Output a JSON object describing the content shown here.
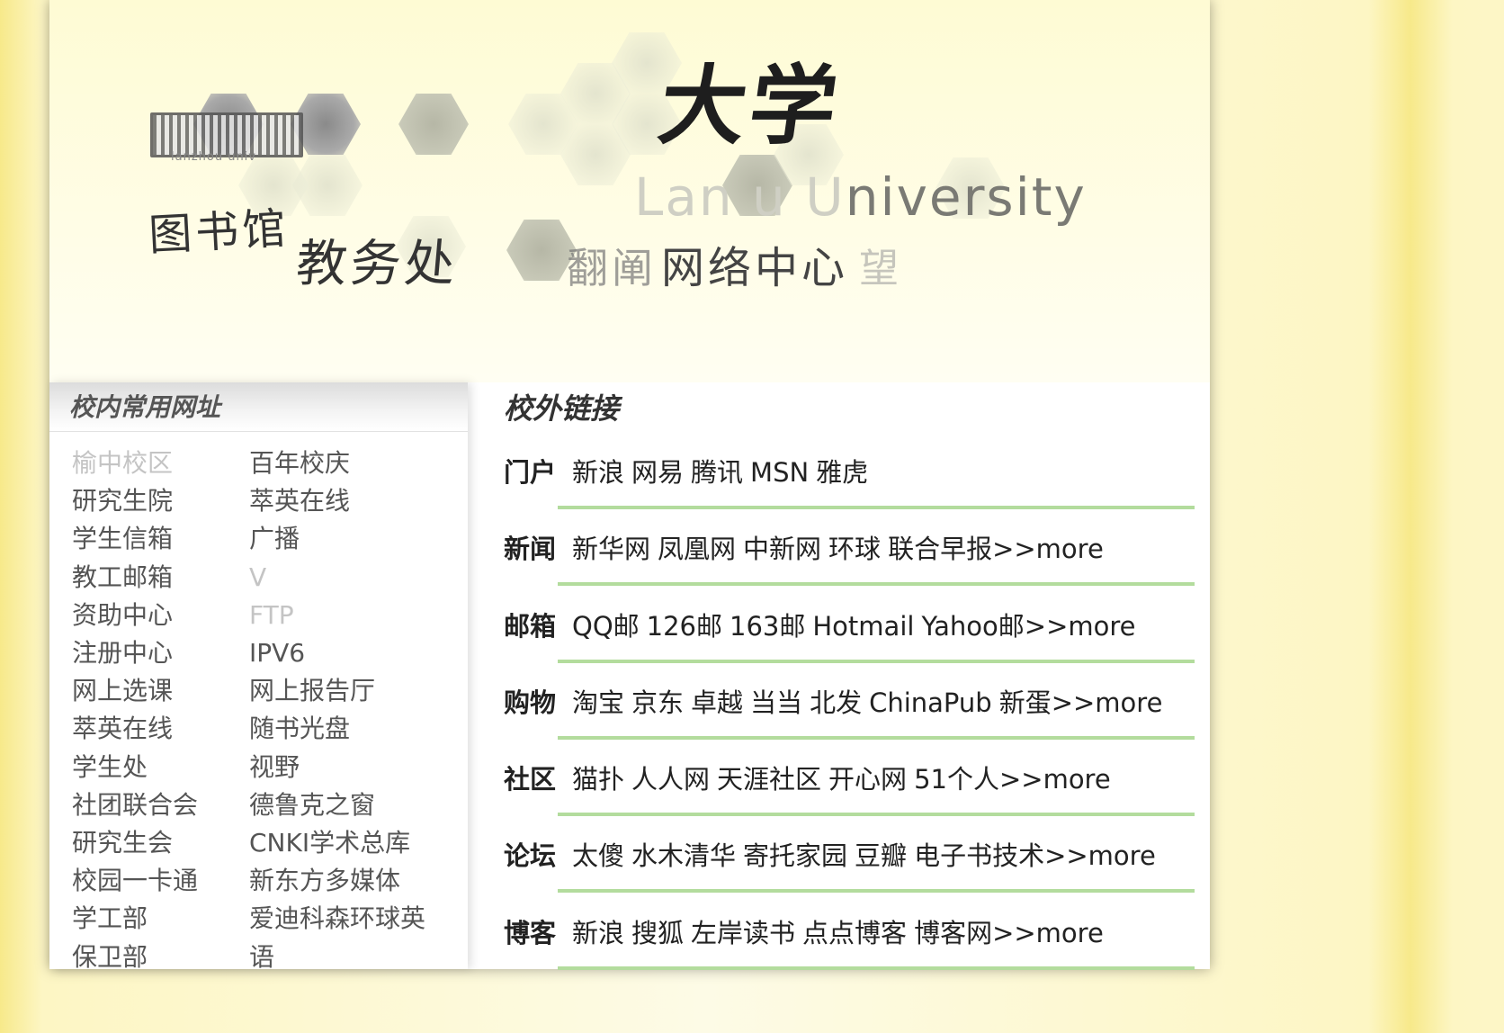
{
  "banner": {
    "title_chars": "大学",
    "english_name": "niversity",
    "english_faded": "Lan  u U",
    "library_label": "图书馆",
    "academic_affairs_label": "教务处",
    "misc_label_1": "翻阐",
    "network_center_label": "网络中心",
    "misc_label_2": "望"
  },
  "left": {
    "title": "校内常用网址",
    "links": [
      {
        "label": "榆中校区",
        "faded": true
      },
      {
        "label": "百年校庆",
        "faded": false
      },
      {
        "label": "研究生院",
        "faded": false
      },
      {
        "label": "萃英在线",
        "faded": false
      },
      {
        "label": "学生信箱",
        "faded": false
      },
      {
        "label": "广播",
        "faded": false
      },
      {
        "label": "教工邮箱",
        "faded": false
      },
      {
        "label": "V",
        "faded": true
      },
      {
        "label": "资助中心",
        "faded": false
      },
      {
        "label": "FTP",
        "faded": true
      },
      {
        "label": "注册中心",
        "faded": false
      },
      {
        "label": "IPV6",
        "faded": false
      },
      {
        "label": "网上选课",
        "faded": false
      },
      {
        "label": "网上报告厅",
        "faded": false
      },
      {
        "label": "萃英在线",
        "faded": false
      },
      {
        "label": "随书光盘",
        "faded": false
      },
      {
        "label": "学生处",
        "faded": false
      },
      {
        "label": "视野",
        "faded": false
      },
      {
        "label": "社团联合会",
        "faded": false
      },
      {
        "label": "德鲁克之窗",
        "faded": false
      },
      {
        "label": "研究生会",
        "faded": false
      },
      {
        "label": "CNKI学术总库",
        "faded": false
      },
      {
        "label": "校园一卡通",
        "faded": false
      },
      {
        "label": "新东方多媒体",
        "faded": false
      },
      {
        "label": "学工部",
        "faded": false
      },
      {
        "label": "爱迪科森环球英",
        "faded": false
      },
      {
        "label": "保卫部",
        "faded": false
      },
      {
        "label": "语",
        "faded": false
      }
    ]
  },
  "right": {
    "title": "校外链接",
    "categories": [
      {
        "name": "门户",
        "sites": [
          "新浪",
          "网易",
          "腾讯",
          "MSN",
          "雅虎"
        ],
        "more": ""
      },
      {
        "name": "新闻",
        "sites": [
          "新华网",
          "凤凰网",
          "中新网",
          "环球",
          "联合早报"
        ],
        "more": ">>more"
      },
      {
        "name": "邮箱",
        "sites": [
          "QQ邮",
          "126邮",
          "163邮",
          "Hotmail",
          "Yahoo邮"
        ],
        "more": ">>more"
      },
      {
        "name": "购物",
        "sites": [
          "淘宝",
          "京东",
          "卓越",
          "当当",
          "北发",
          "ChinaPub",
          "新蛋"
        ],
        "more": ">>more"
      },
      {
        "name": "社区",
        "sites": [
          "猫扑",
          "人人网",
          "天涯社区",
          "开心网",
          "51个人"
        ],
        "more": ">>more"
      },
      {
        "name": "论坛",
        "sites": [
          "太傻",
          "水木清华",
          "寄托家园",
          "豆瓣",
          "电子书技术"
        ],
        "more": ">>more"
      },
      {
        "name": "博客",
        "sites": [
          "新浪",
          "搜狐",
          "左岸读书",
          "点点博客",
          "博客网"
        ],
        "more": ">>more"
      }
    ]
  }
}
